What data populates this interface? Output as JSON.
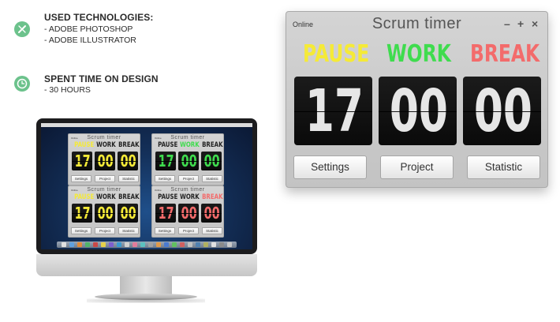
{
  "info": {
    "technologies": {
      "icon": "pencil-ruler-icon",
      "heading": "USED TECHNOLOGIES:",
      "lines": [
        "- ADOBE PHOTOSHOP",
        "- ADOBE ILLUSTRATOR"
      ]
    },
    "time": {
      "icon": "clock-icon",
      "heading": "SPENT TIME ON DESIGN",
      "lines": [
        "- 30 HOURS"
      ]
    }
  },
  "timer": {
    "status": "Online",
    "title": "Scrum  timer",
    "controls": [
      "–",
      "+",
      "×"
    ],
    "states": {
      "pause": "PAUSE",
      "work": "WORK",
      "break": "BREAK"
    },
    "digits": [
      "17",
      "00",
      "00"
    ],
    "buttons": {
      "settings": "Settings",
      "project": "Project",
      "statistic": "Statistic"
    }
  },
  "mini_timers": [
    {
      "status": "Online",
      "title": "Scrum  timer",
      "active": "pause",
      "digits": [
        "17",
        "00",
        "00"
      ],
      "buttons": [
        "Settings",
        "Project",
        "Statistic"
      ]
    },
    {
      "status": "Online",
      "title": "Scrum  timer",
      "active": "work",
      "digits": [
        "17",
        "00",
        "00"
      ],
      "buttons": [
        "Settings",
        "Project",
        "Statistic"
      ]
    },
    {
      "status": "Online",
      "title": "Scrum  timer",
      "active": "pause",
      "digits": [
        "17",
        "00",
        "00"
      ],
      "buttons": [
        "Settings",
        "Project",
        "Statistic"
      ]
    },
    {
      "status": "Online",
      "title": "Scrum  timer",
      "active": "break",
      "digits": [
        "17",
        "00",
        "00"
      ],
      "buttons": [
        "Settings",
        "Project",
        "Statistic"
      ]
    }
  ],
  "colors": {
    "accent_icon": "#6cc28c",
    "pause": "#f5ea37",
    "work": "#3fdc4e",
    "break": "#f36b6b",
    "inactive": "#222222",
    "window_bg": "#cdcdcd",
    "digit_bg": "#111111"
  }
}
